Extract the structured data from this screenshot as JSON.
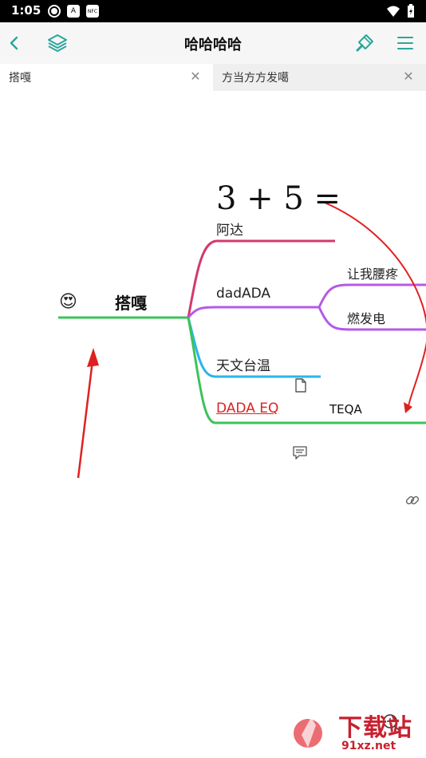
{
  "status": {
    "time": "1:05",
    "icon_a": "A",
    "icon_nfc": "NFC"
  },
  "toolbar": {
    "title": "哈哈哈哈"
  },
  "tabs": [
    {
      "label": "搭嘎"
    },
    {
      "label": "方当方方发噶"
    }
  ],
  "mindmap": {
    "root": "搭嘎",
    "emoji": "😍",
    "formula": "3 + 5 =",
    "branches": {
      "b1": "阿达",
      "b2": "dadADA",
      "b2_child1": "让我腰疼",
      "b2_child2": "燃发电",
      "b3": "天文台温",
      "b4_link": "DADA EQ",
      "b4_text": "TEQA"
    },
    "colors": {
      "root_line": "#3cc35a",
      "branch1": "#d23a6a",
      "branch2": "#b45be6",
      "branch3": "#29b6e8",
      "branch4": "#3cc35a",
      "arrow": "#e02020",
      "accent": "#2aa69b"
    }
  },
  "watermark": {
    "big": "下载站",
    "small": "91xz.net"
  }
}
